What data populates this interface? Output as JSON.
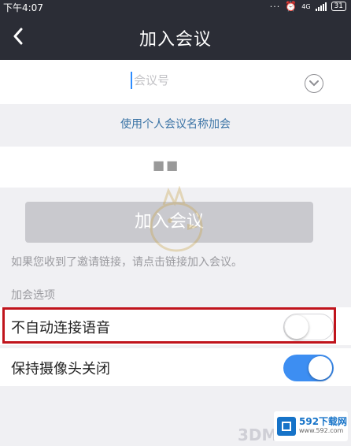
{
  "status_bar": {
    "time": "下午4:07",
    "battery": "31",
    "network": "4G"
  },
  "header": {
    "title": "加入会议"
  },
  "meeting_id": {
    "placeholder": "会议号",
    "value": ""
  },
  "personal_link": "使用个人会议名称加会",
  "display_name": "■■",
  "join_button": "加入会议",
  "hint": "如果您收到了邀请链接，请点击链接加入会议。",
  "options": {
    "section_label": "加会选项",
    "items": [
      {
        "label": "不自动连接语音",
        "enabled": false
      },
      {
        "label": "保持摄像头关闭",
        "enabled": true
      }
    ]
  },
  "watermark": {
    "site": "592下载网",
    "url": "www.592.com",
    "brand": "3DM"
  },
  "colors": {
    "accent": "#3d8ef2",
    "highlight": "#c0141c",
    "header_bg": "#2b2d36"
  }
}
